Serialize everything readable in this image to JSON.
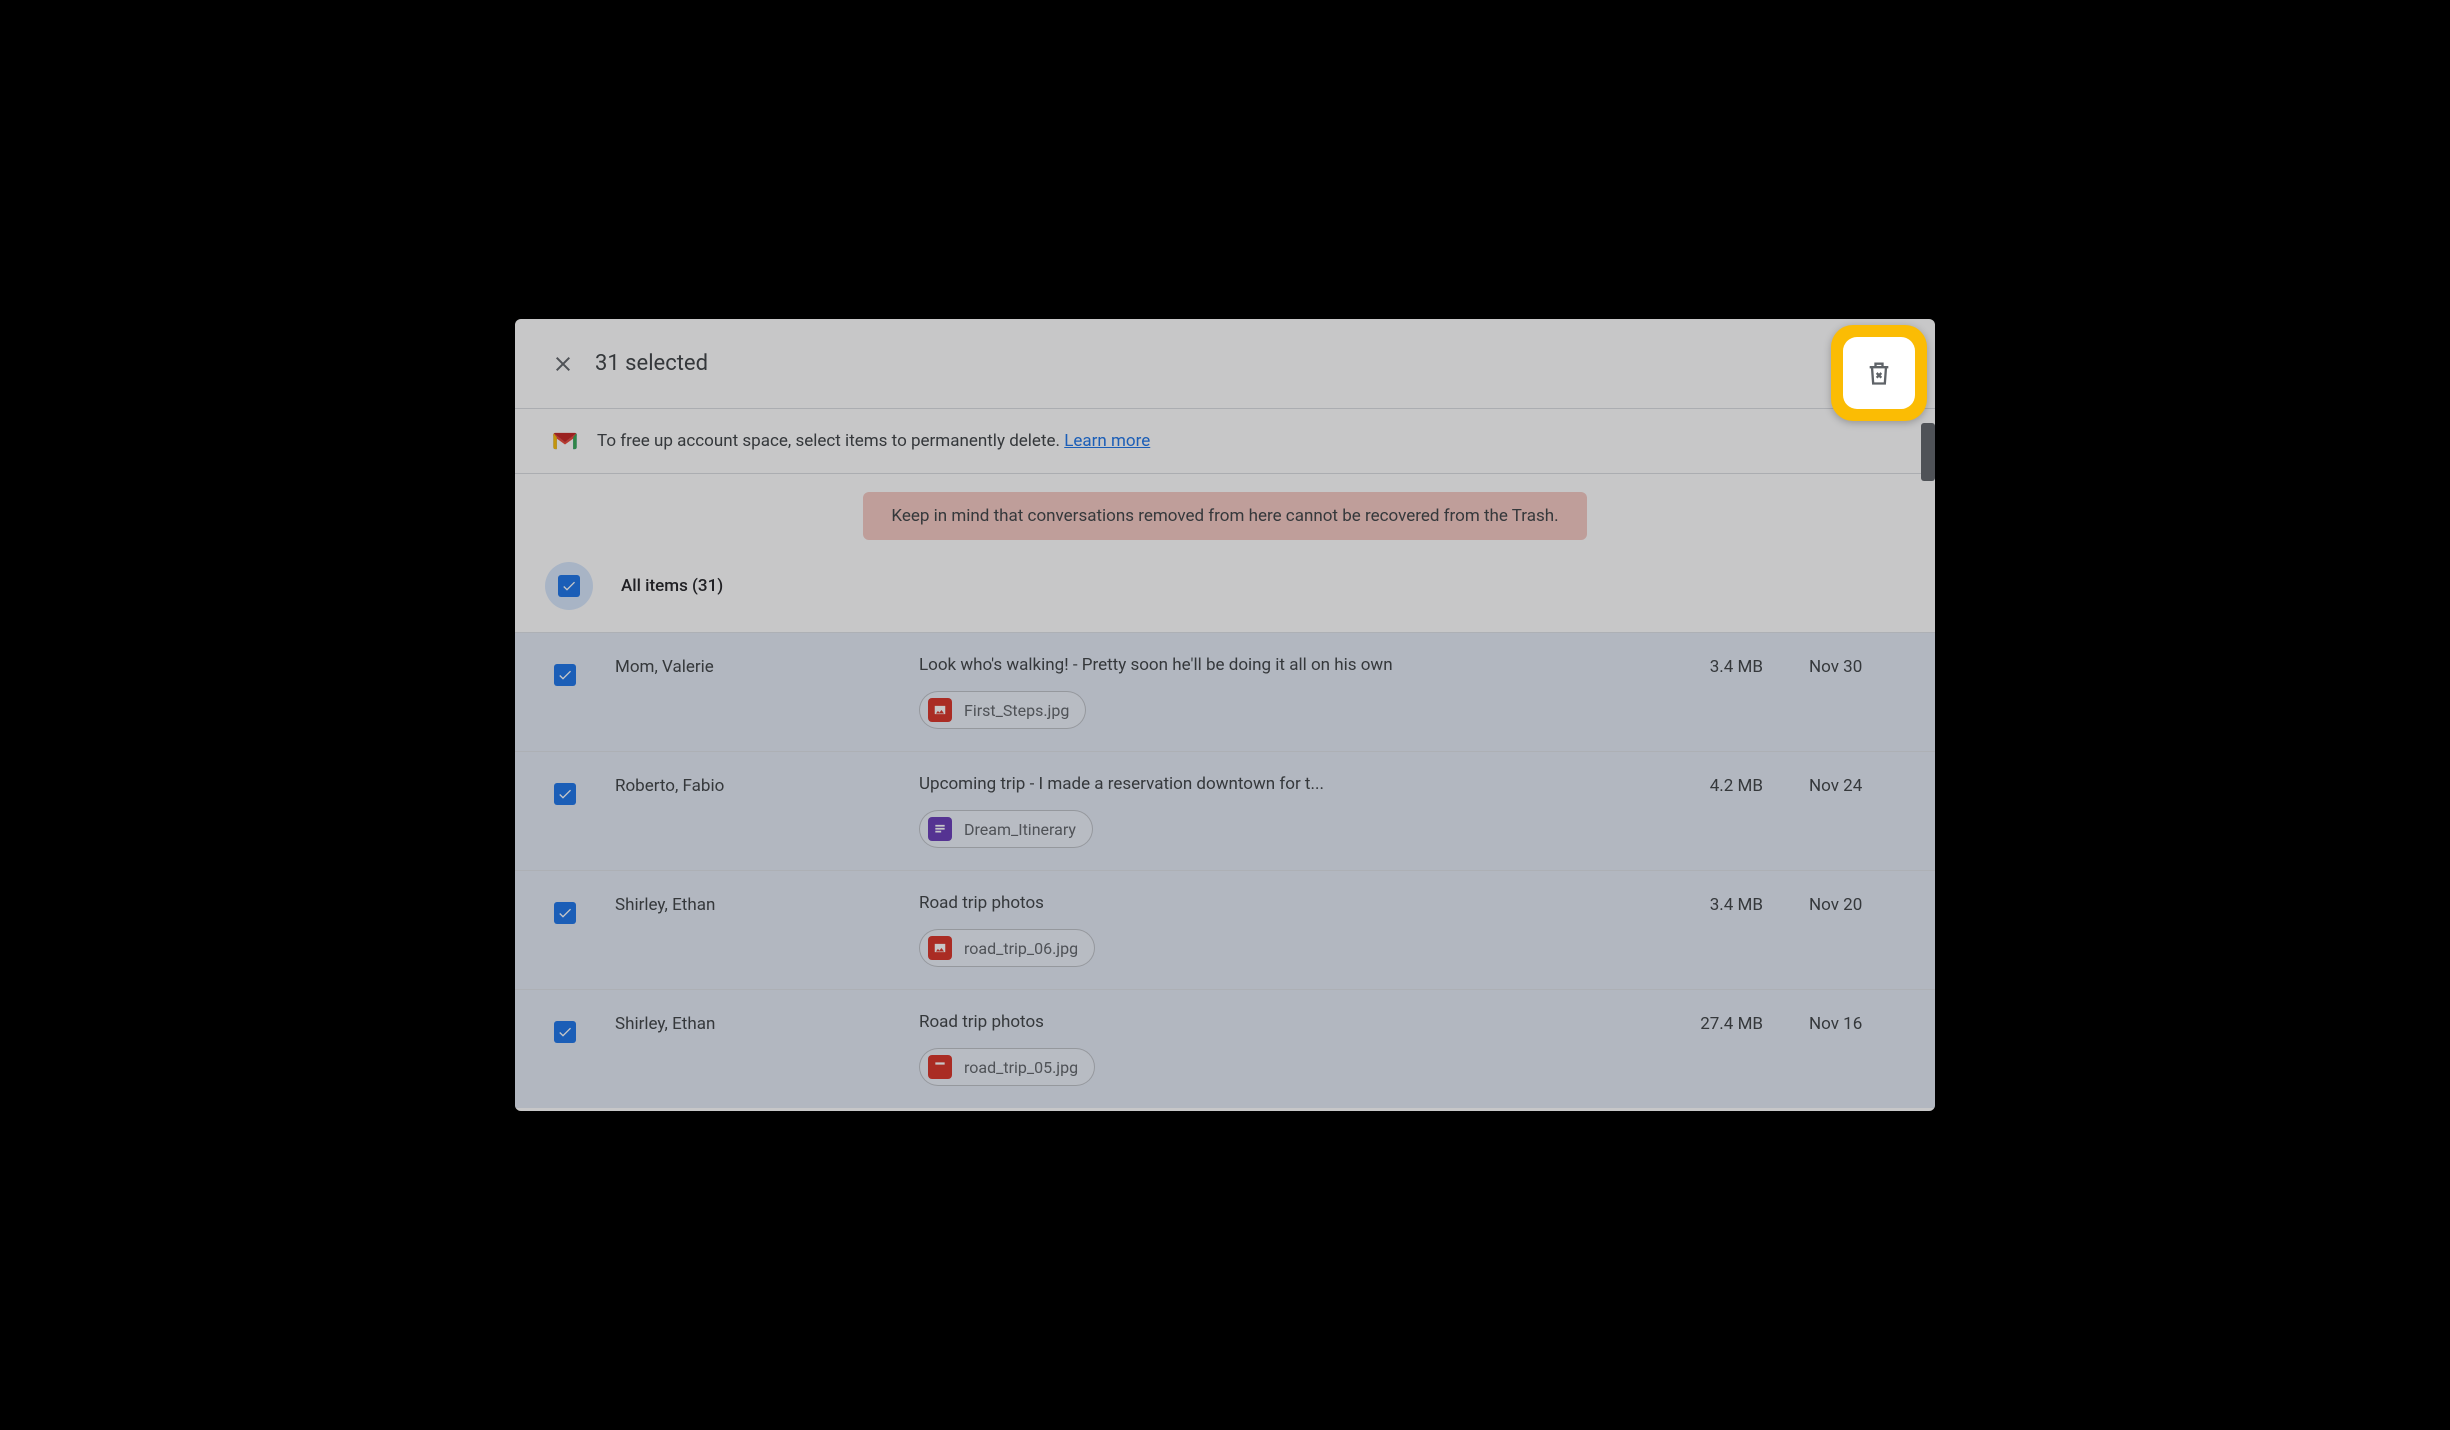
{
  "header": {
    "selected_text": "31 selected"
  },
  "info": {
    "text": "To free up account space, select items to permanently delete. ",
    "link": "Learn more"
  },
  "warning": "Keep in mind that conversations removed from here cannot be recovered from the Trash.",
  "all_items_label": "All items (31)",
  "emails": [
    {
      "sender": "Mom, Valerie",
      "subject": "Look who's walking! - Pretty soon he'll be doing it all on his own",
      "attachment": "First_Steps.jpg",
      "attachment_type": "image",
      "size": "3.4 MB",
      "date": "Nov 30"
    },
    {
      "sender": "Roberto, Fabio",
      "subject": "Upcoming trip - I made a reservation downtown for t...",
      "attachment": "Dream_Itinerary",
      "attachment_type": "doc",
      "size": "4.2 MB",
      "date": "Nov 24"
    },
    {
      "sender": "Shirley, Ethan",
      "subject": "Road trip photos",
      "attachment": "road_trip_06.jpg",
      "attachment_type": "image",
      "size": "3.4 MB",
      "date": "Nov 20"
    },
    {
      "sender": "Shirley, Ethan",
      "subject": "Road trip photos",
      "attachment": "road_trip_05.jpg",
      "attachment_type": "video",
      "size": "27.4 MB",
      "date": "Nov 16"
    }
  ]
}
